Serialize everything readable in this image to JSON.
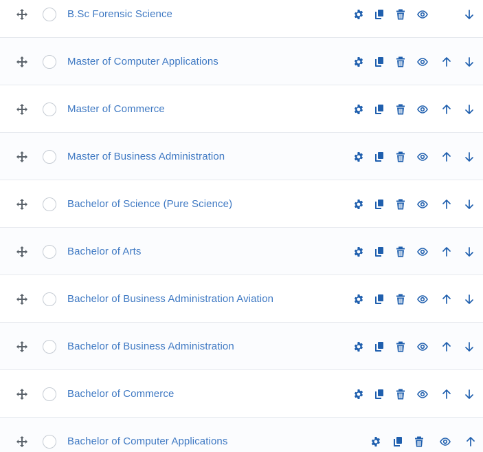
{
  "colors": {
    "link": "#3f79c3",
    "action_icon": "#1f5fae",
    "drag_icon": "#5b636b",
    "divider": "#e6e9ee"
  },
  "icons": {
    "drag": "move-arrows-icon",
    "select": "circle-checkbox",
    "settings": "gear-icon",
    "duplicate": "copy-icon",
    "delete": "trash-icon",
    "visibility": "eye-icon",
    "move_up": "arrow-up-icon",
    "move_down": "arrow-down-icon"
  },
  "items": [
    {
      "title": "B.Sc Forensic Science",
      "show_up": false,
      "show_down": true
    },
    {
      "title": "Master of Computer Applications",
      "show_up": true,
      "show_down": true
    },
    {
      "title": "Master of Commerce",
      "show_up": true,
      "show_down": true
    },
    {
      "title": "Master of Business Administration",
      "show_up": true,
      "show_down": true
    },
    {
      "title": "Bachelor of Science (Pure Science)",
      "show_up": true,
      "show_down": true
    },
    {
      "title": "Bachelor of Arts",
      "show_up": true,
      "show_down": true
    },
    {
      "title": "Bachelor of Business Administration Aviation",
      "show_up": true,
      "show_down": true
    },
    {
      "title": "Bachelor of Business Administration",
      "show_up": true,
      "show_down": true
    },
    {
      "title": "Bachelor of Commerce",
      "show_up": true,
      "show_down": true
    },
    {
      "title": "Bachelor of Computer Applications",
      "show_up": true,
      "show_down": false
    }
  ]
}
